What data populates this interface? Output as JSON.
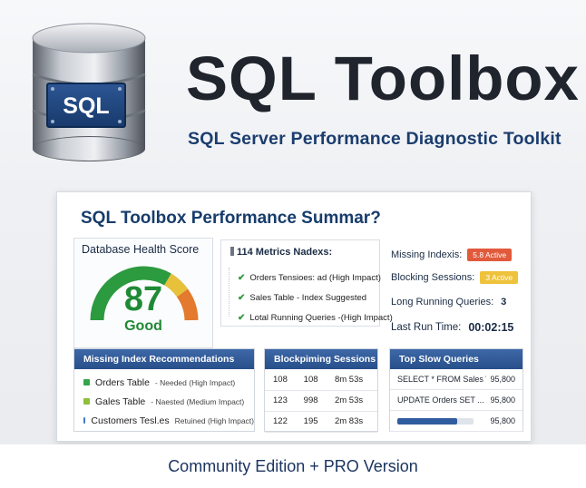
{
  "header": {
    "db_icon_label": "SQL",
    "title": "SQL Toolbox",
    "subtitle": "SQL Server Performance Diagnostic Toolkit"
  },
  "panel": {
    "title": "SQL  Toolbox Performance Summar?",
    "health": {
      "label": "Database Health Score",
      "score": "87",
      "score_fraction": 0.87,
      "status": "Good"
    },
    "metrics": {
      "title": "114 Metrics Nadexs:",
      "items": [
        "Orders Tensioes: ad (High Impact)",
        "Sales Table - Index Suggested",
        "Lotal Running Queries -(High Impact)"
      ]
    },
    "status": {
      "missing_label": "Missing Indexis:",
      "missing_badge": "5.8 Active",
      "blocking_label": "Blocking Sessions:",
      "blocking_badge": "3 Active",
      "long_label": "Long Running Queries:",
      "long_value": "3",
      "last_run_label": "Last Run Time:",
      "last_run_value": "00:02:15"
    },
    "recommendations": {
      "title": "Missing Index Recommendations",
      "rows": [
        {
          "name": "Orders Table",
          "note": "- Needed (High Impact)"
        },
        {
          "name": "Gales Table",
          "note": "- Naested (Medium Impact)"
        },
        {
          "name": "Customers Tesl.es",
          "note": "Retuined (High Impact)"
        }
      ]
    },
    "sessions": {
      "title": "Blockpiming Sessions",
      "rows": [
        [
          "108",
          "108",
          "8m 53s"
        ],
        [
          "123",
          "998",
          "2m 53s"
        ],
        [
          "122",
          "195",
          "2m 83s"
        ]
      ]
    },
    "slow_queries": {
      "title": "Top Slow Queries",
      "rows": [
        {
          "text": "SELECT * FROM Sales WHERE...",
          "value": "95,800"
        },
        {
          "text": "UPDATE Orders SET ...",
          "value": "95,800"
        },
        {
          "text": "",
          "value": "95,800"
        }
      ],
      "bar_fraction": 0.78
    }
  },
  "footer": {
    "text": "Community Edition + PRO Version"
  },
  "colors": {
    "brand_blue": "#1b3d6e",
    "good_green": "#1f8a35",
    "badge_red": "#e15a3c",
    "badge_yellow": "#eec23a",
    "card_header": "#2f5c9e"
  },
  "icons": [
    "database-icon",
    "check-icon",
    "gauge-needle"
  ]
}
